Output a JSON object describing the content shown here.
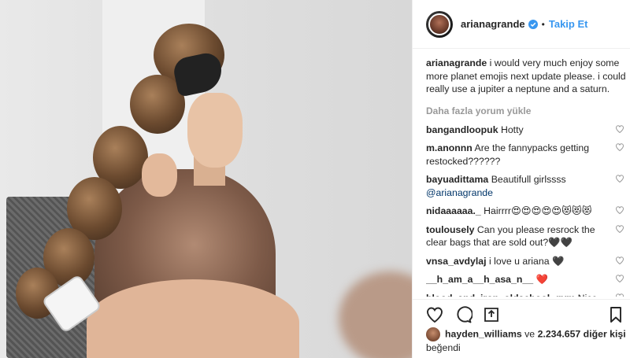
{
  "post": {
    "username": "arianagrande",
    "follow_label": "Takip Et",
    "caption_user": "arianagrande",
    "caption_text": " i would very much enjoy some more planet emojis next update please. i could really use a jupiter a neptune and a saturn.",
    "load_more": "Daha fazla yorum yükle"
  },
  "comments": [
    {
      "user": "bangandloopuk",
      "text": " Hotty",
      "liked": false
    },
    {
      "user": "m.anonnn",
      "text": " Are the fannypacks getting restocked??????",
      "liked": false
    },
    {
      "user": "bayuadittama",
      "text": " Beautifull girlssss ",
      "mention": "@arianagrande",
      "liked": false
    },
    {
      "user": "nidaaaaaa._",
      "text": " Hairrrr😍😍😍😍😍😻😻😻",
      "liked": false
    },
    {
      "user": "toulousely",
      "text": " Can you please resrock the clear bags that are sold out?🖤🖤",
      "liked": false
    },
    {
      "user": "vnsa_avdylaj",
      "text": " i love u ariana 🖤",
      "liked": false
    },
    {
      "user": "__h_am_a__h_asa_n__",
      "text": " ❤️",
      "liked": false
    },
    {
      "user": "blood_and_iron_oldschool_gym",
      "text": " Nice",
      "liked": false
    }
  ],
  "likes": {
    "first_user": "hayden_williams",
    "rest": " ve ",
    "count": "2.234.657 diğer kişi",
    "suffix": " beğendi"
  },
  "colors": {
    "accent": "#3897f0",
    "verified": "#3897f0"
  },
  "icons": [
    "heart-icon",
    "comment-icon",
    "share-icon",
    "bookmark-icon",
    "verified-badge-icon"
  ]
}
